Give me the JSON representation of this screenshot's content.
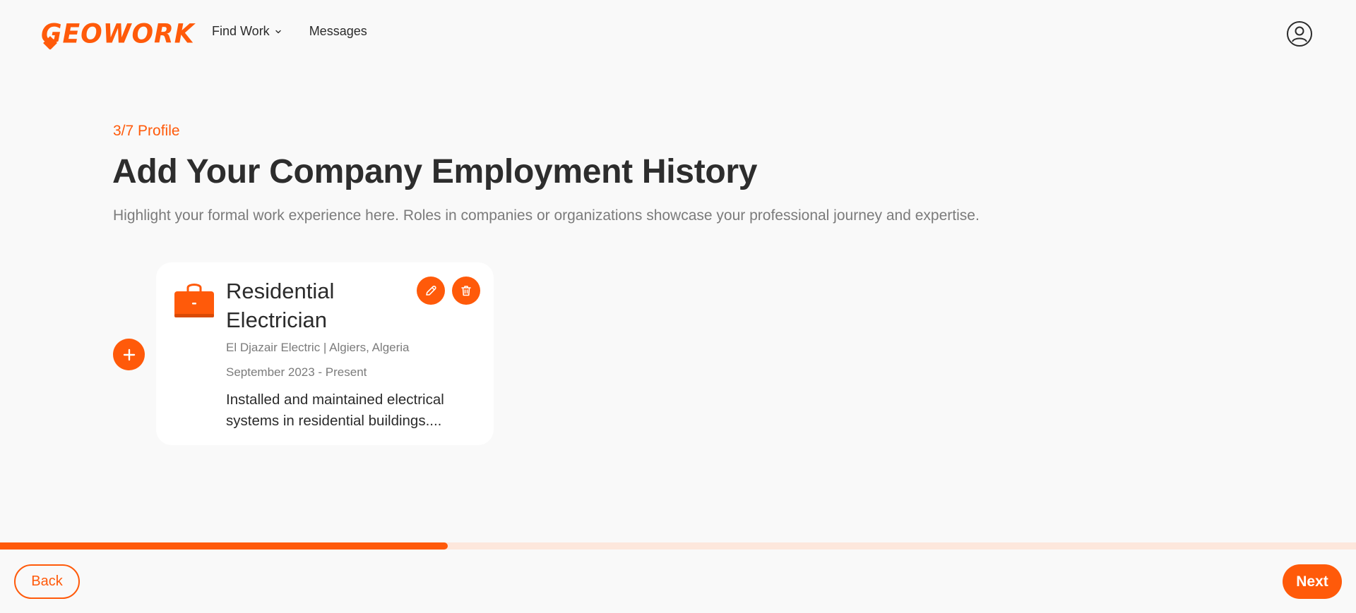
{
  "header": {
    "logo_text": "GEOWORK",
    "nav": [
      {
        "label": "Find Work",
        "icon": "chevron-down-icon"
      },
      {
        "label": "Messages"
      }
    ],
    "profile_icon": "user-circle-icon"
  },
  "main": {
    "step": "3/7 Profile",
    "title": "Add Your Company Employment History",
    "subtitle": "Highlight your formal work experience here. Roles in companies or organizations showcase your professional journey and expertise.",
    "add_icon": "plus-icon"
  },
  "entries": [
    {
      "icon": "briefcase-icon",
      "title": "Residential Electrician",
      "company_location": "El Djazair Electric | Algiers, Algeria",
      "dates": "September 2023 - Present",
      "description": "Installed and maintained electrical systems in residential buildings....",
      "actions": [
        "edit-icon",
        "trash-icon"
      ]
    }
  ],
  "progress": {
    "fraction": 0.33
  },
  "footer": {
    "back_label": "Back",
    "next_label": "Next"
  },
  "colors": {
    "accent": "#ff5a0a",
    "accent_light": "#fde7dc",
    "background": "#f9f9f9",
    "card": "#ffffff",
    "text_dark": "#2d2d2d",
    "text_muted": "#7b7b7b"
  }
}
